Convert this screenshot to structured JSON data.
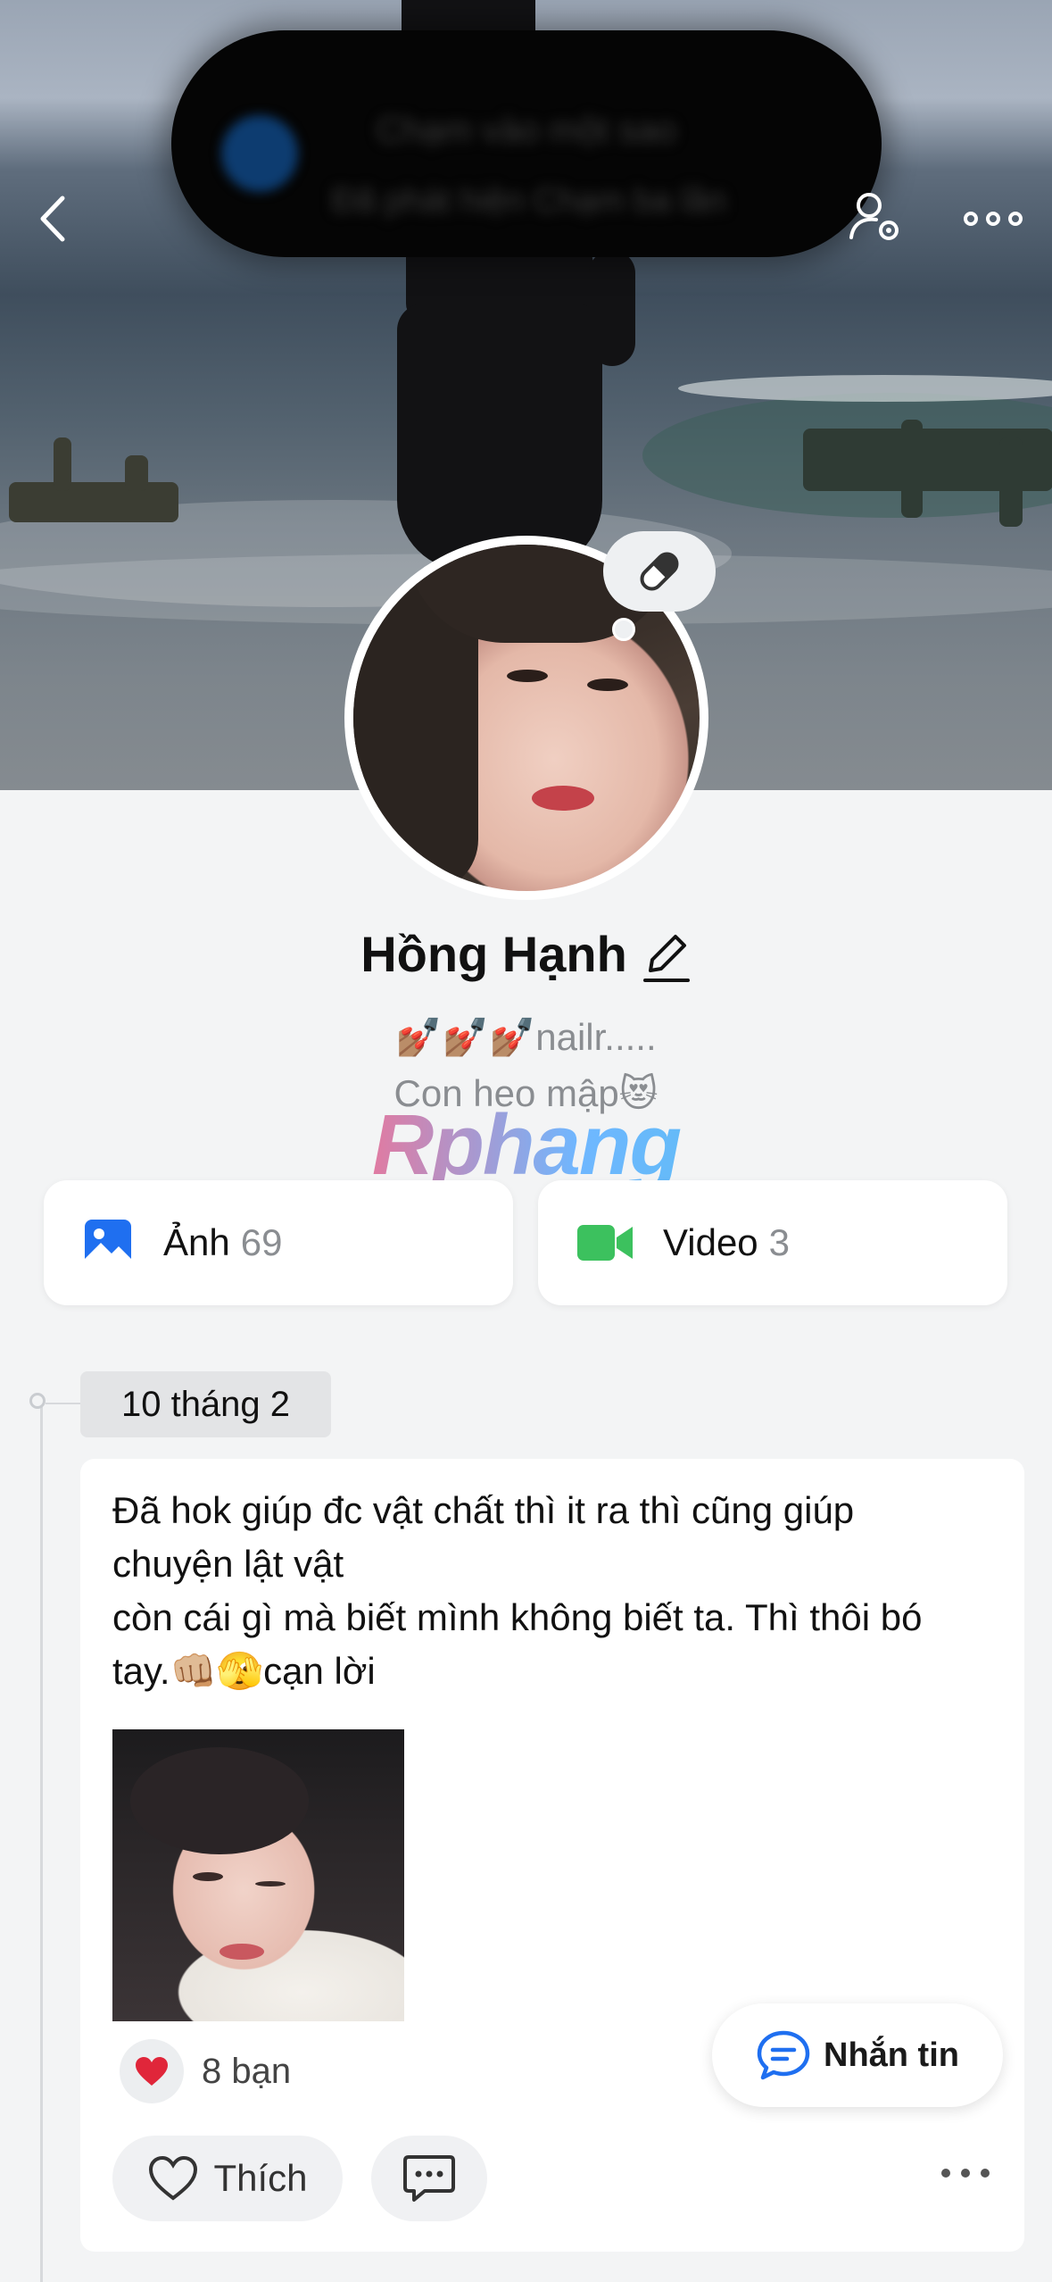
{
  "notification": {
    "title": "Chạm vào một sao",
    "subtitle": "Đã phát hiện Chạm ba lần"
  },
  "profile": {
    "name": "Hồng Hạnh",
    "bio_line1": "💅🏽💅🏽💅🏽nailr.....",
    "bio_line2": "Con heo mập😻"
  },
  "watermark": "Rphang",
  "media": {
    "photos_label": "Ảnh",
    "photos_count": "69",
    "videos_label": "Video",
    "videos_count": "3"
  },
  "post": {
    "date": "10 tháng 2",
    "text": "Đã hok giúp đc vật chất thì it ra thì cũng giúp\nchuyện lật vật\ncòn cái gì mà biết mình không biết ta. Thì thôi bó\ntay.👊🏼🫣cạn lời",
    "reactions_count": "8 bạn",
    "like_label": "Thích"
  },
  "chat_button": "Nhắn tin",
  "colors": {
    "accent_blue": "#1f6ff0",
    "video_green": "#3cc15e",
    "heart_red": "#e0263a"
  },
  "icons": [
    "back-icon",
    "settings-user-icon",
    "more-icon",
    "pill-icon",
    "edit-pencil-icon",
    "photo-icon",
    "video-icon",
    "heart-icon",
    "comment-icon",
    "chat-icon"
  ]
}
